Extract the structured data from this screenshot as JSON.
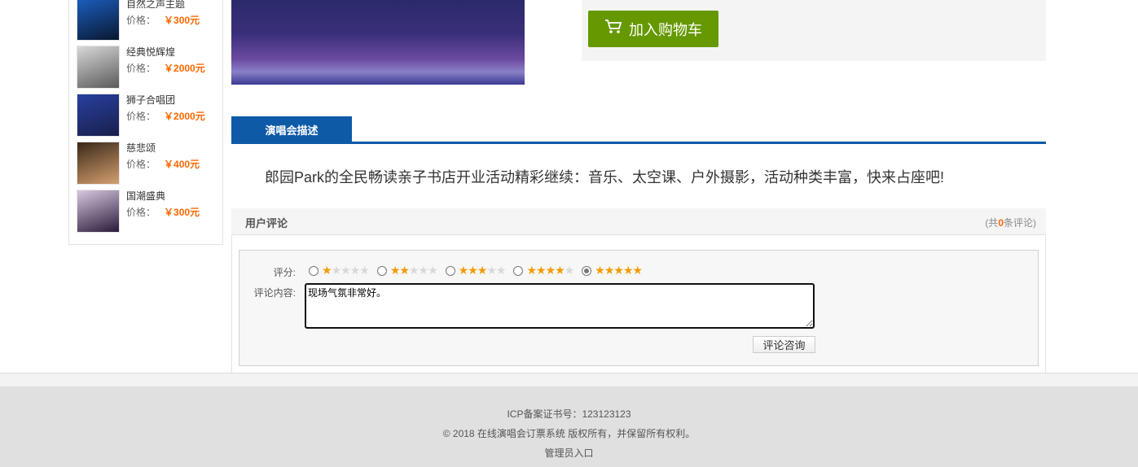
{
  "sidebar": {
    "items": [
      {
        "name": "自然之声主题",
        "price_label": "价格：",
        "price": "￥300元",
        "colors": [
          "#1b5fbf",
          "#0a1730"
        ]
      },
      {
        "name": "经典悦辉煌",
        "price_label": "价格：",
        "price": "￥2000元",
        "colors": [
          "#d8d8d8",
          "#5a5a5a"
        ]
      },
      {
        "name": "狮子合唱团",
        "price_label": "价格：",
        "price": "￥2000元",
        "colors": [
          "#2740a0",
          "#1a1f4a"
        ]
      },
      {
        "name": "慈悲颂",
        "price_label": "价格：",
        "price": "￥400元",
        "colors": [
          "#3a2818",
          "#d4a070"
        ]
      },
      {
        "name": "国潮盛典",
        "price_label": "价格：",
        "price": "￥300元",
        "colors": [
          "#d8c8e0",
          "#2a1a3a"
        ]
      }
    ]
  },
  "buy": {
    "cart_label": "加入购物车",
    "icon": "cart-icon"
  },
  "tabs": {
    "description": "演唱会描述"
  },
  "description": "郎园Park的全民畅读亲子书店开业活动精彩继续：音乐、太空课、户外摄影，活动种类丰富，快来占座吧!",
  "comments": {
    "title": "用户评论",
    "count_prefix": "(共",
    "count": "0",
    "count_suffix": "条评论)",
    "rating_label": "评分:",
    "rating_selected": 5,
    "rating_max": 5,
    "content_label": "评论内容:",
    "content_value": "现场气氛非常好。",
    "submit_label": "评论咨询"
  },
  "footer": {
    "icp": "ICP备案证书号：123123123",
    "copyright": "© 2018 在线演唱会订票系统 版权所有，并保留所有权利。",
    "admin_link": "管理员入口"
  },
  "colors": {
    "accent_blue": "#0e5aa7",
    "buy_green": "#669900",
    "price_orange": "#ff6600"
  }
}
